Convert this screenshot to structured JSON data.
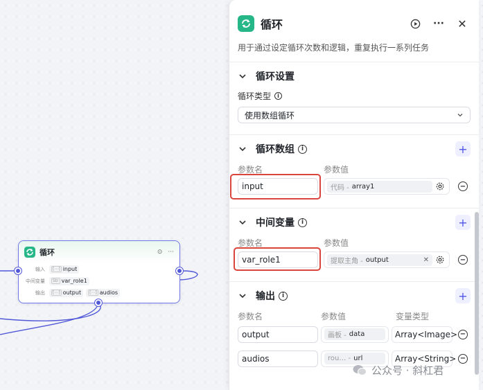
{
  "node": {
    "title": "循环",
    "input_label": "输入",
    "input_var": "input",
    "input_type": "[⋯]",
    "middle_label": "中间变量",
    "middle_var": "var_role1",
    "middle_type": "Str",
    "output_label": "输出",
    "output_vars": [
      "output",
      "audios"
    ],
    "output_type": "[⋯]"
  },
  "panel": {
    "title": "循环",
    "description": "用于通过设定循环次数和逻辑，重复执行一系列任务",
    "loop_settings": {
      "title": "循环设置",
      "type_label": "循环类型",
      "type_value": "使用数组循环"
    },
    "loop_array": {
      "title": "循环数组",
      "col_name": "参数名",
      "col_value": "参数值",
      "rows": [
        {
          "name": "input",
          "ref_source": "代码 -",
          "ref_var": "array1"
        }
      ]
    },
    "middle_vars": {
      "title": "中间变量",
      "col_name": "参数名",
      "col_value": "参数值",
      "rows": [
        {
          "name": "var_role1",
          "ref_source": "提取主角 -",
          "ref_var": "output"
        }
      ]
    },
    "outputs": {
      "title": "输出",
      "col_name": "参数名",
      "col_value": "参数值",
      "col_type": "变量类型",
      "rows": [
        {
          "name": "output",
          "ref_source": "画板 -",
          "ref_var": "data",
          "type": "Array<Image>"
        },
        {
          "name": "audios",
          "ref_source": "rou… -",
          "ref_var": "url",
          "type": "Array<String>"
        }
      ]
    }
  },
  "watermark": "公众号 · 斜杠君",
  "icons": {
    "loop": "loop-icon",
    "run": "play-icon",
    "more": "more-icon",
    "close": "close-icon",
    "collapse": "chevron-down-icon",
    "info": "info-icon",
    "add": "plus-icon",
    "settings": "gear-icon",
    "remove": "minus-circle-icon",
    "clear": "close-small-icon"
  },
  "colors": {
    "accent": "#4d53e8",
    "loop_green": "#26b789",
    "highlight": "#d9443c",
    "wire": "#5058d8"
  }
}
